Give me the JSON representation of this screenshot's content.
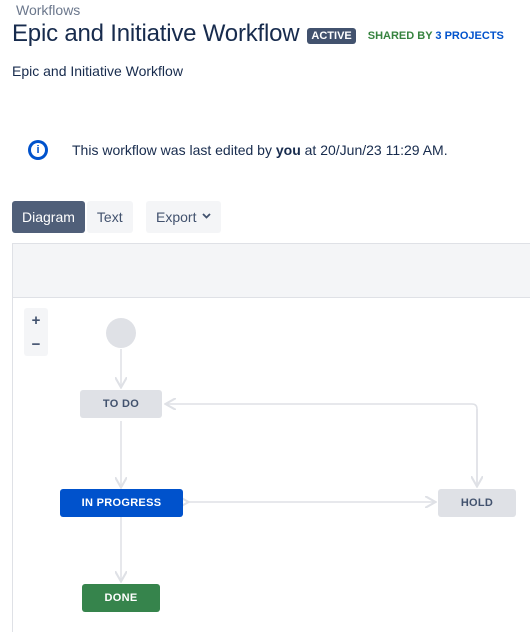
{
  "breadcrumb": "Workflows",
  "header": {
    "title": "Epic and Initiative Workflow",
    "status_badge": "ACTIVE",
    "shared_prefix": "SHARED BY",
    "shared_link": "3 PROJECTS"
  },
  "description": "Epic and Initiative Workflow",
  "info": {
    "icon": "info-icon",
    "text_before": "This workflow was last edited by",
    "user": "you",
    "text_after": "at 20/Jun/23 11:29 AM."
  },
  "view_tabs": [
    {
      "label": "Diagram",
      "active": true
    },
    {
      "label": "Text",
      "active": false
    }
  ],
  "export": {
    "label": "Export",
    "icon": "chevron-down-icon"
  },
  "zoom": {
    "in": "+",
    "out": "−"
  },
  "diagram": {
    "statuses": [
      {
        "key": "todo",
        "label": "TO DO"
      },
      {
        "key": "inprog",
        "label": "IN PROGRESS"
      },
      {
        "key": "hold",
        "label": "HOLD"
      },
      {
        "key": "done",
        "label": "DONE"
      }
    ],
    "colors": {
      "todo": "#dfe1e6",
      "in_progress": "#0052cc",
      "hold": "#dfe1e6",
      "done": "#36844c"
    }
  }
}
